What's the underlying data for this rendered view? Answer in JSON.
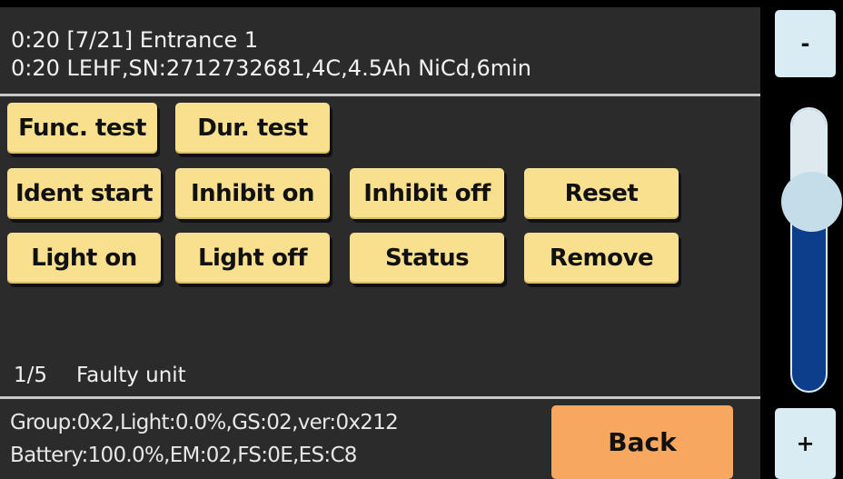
{
  "header": {
    "line1": "0:20 [7/21] Entrance 1",
    "line2": "0:20 LEHF,SN:2712732681,4C,4.5Ah NiCd,6min"
  },
  "buttons": {
    "func_test": "Func. test",
    "dur_test": "Dur. test",
    "ident_start": "Ident start",
    "inhibit_on": "Inhibit on",
    "inhibit_off": "Inhibit off",
    "reset": "Reset",
    "light_on": "Light on",
    "light_off": "Light off",
    "status": "Status",
    "remove": "Remove"
  },
  "status": {
    "page": "1/5",
    "text": "Faulty unit"
  },
  "footer": {
    "line1": "Group:0x2,Light:0.0%,GS:02,ver:0x212",
    "line2": "Battery:100.0%,EM:02,FS:0E,ES:C8",
    "back_label": "Back"
  },
  "side": {
    "minus_label": "-",
    "plus_label": "+",
    "slider_fraction_from_top": 0.3
  },
  "colors": {
    "button_bg": "#f8e08f",
    "back_bg": "#f7a75e",
    "panel_bg": "#2b2b2b",
    "slider_track": "#0d3e8c",
    "side_button_bg": "#d9ecf3"
  }
}
